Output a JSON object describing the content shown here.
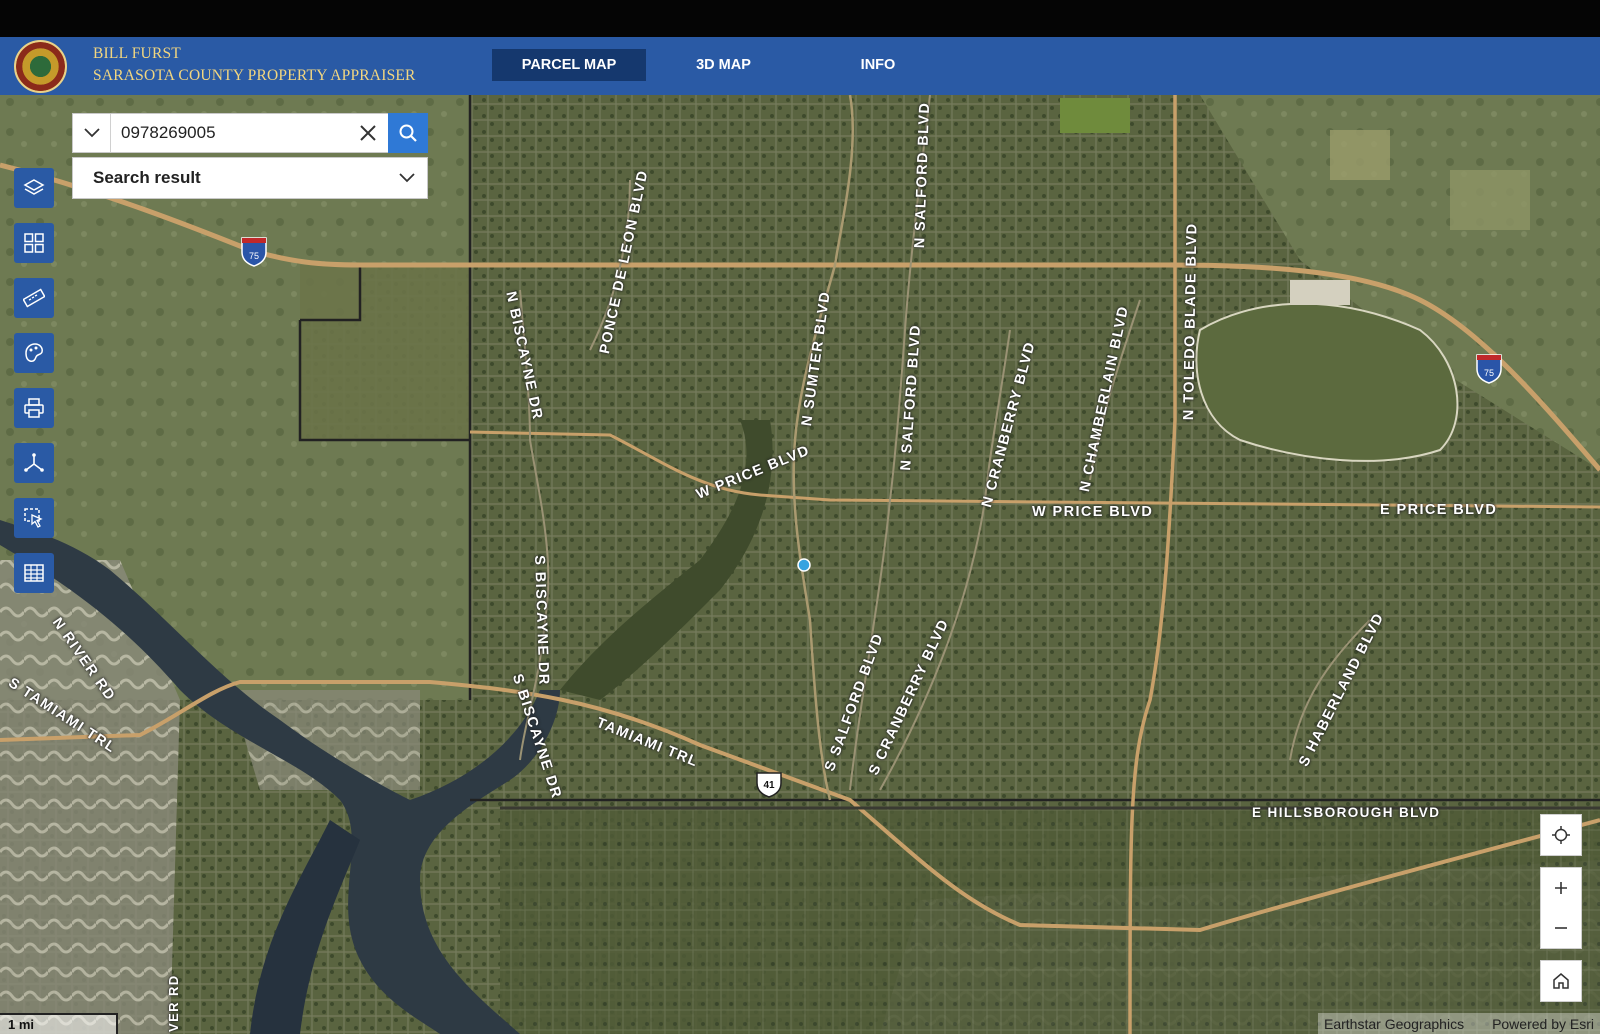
{
  "header": {
    "brand_line1": "BILL FURST",
    "brand_line2": "SARASOTA COUNTY PROPERTY APPRAISER",
    "nav": [
      {
        "label": "PARCEL MAP",
        "active": true
      },
      {
        "label": "3D MAP",
        "active": false
      },
      {
        "label": "INFO",
        "active": false
      }
    ]
  },
  "search": {
    "value": "0978269005",
    "result_label": "Search result"
  },
  "toolbar": [
    "layers-icon",
    "basemap-gallery-icon",
    "measure-icon",
    "legend-icon",
    "print-icon",
    "share-icon",
    "select-icon",
    "table-icon"
  ],
  "map": {
    "road_labels": [
      "N SALFORD BLVD",
      "PONCE DE LEON BLVD",
      "N BISCAYNE DR",
      "N SUMTER BLVD",
      "N SALFORD BLVD",
      "N TOLEDO BLADE BLVD",
      "N CRANBERRY BLVD",
      "N CHAMBERLAIN BLVD",
      "W PRICE BLVD",
      "W PRICE BLVD",
      "E PRICE BLVD",
      "S BISCAYNE DR",
      "N RIVER RD",
      "S TAMIAMI TRL",
      "S BISCAYNE DR",
      "TAMIAMI TRL",
      "S SALFORD BLVD",
      "S CRANBERRY BLVD",
      "S HABERLAND BLVD",
      "E HILLSBOROUGH BLVD",
      "VER RD"
    ],
    "shields": [
      "75",
      "75",
      "41"
    ],
    "scale_label": "1 mi",
    "attribution_1": "Earthstar Geographics",
    "attribution_2": "Powered by Esri"
  }
}
